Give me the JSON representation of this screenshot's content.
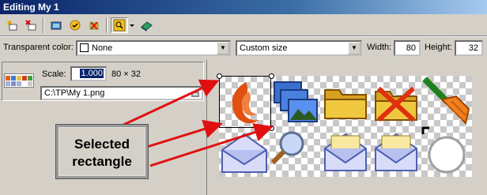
{
  "window": {
    "title": "Editing My 1"
  },
  "toolbar": {
    "buttons": [
      {
        "name": "new-layer-icon"
      },
      {
        "name": "delete-layer-icon"
      },
      {
        "name": "insert-image-icon"
      },
      {
        "name": "apply-icon"
      },
      {
        "name": "clear-icon"
      },
      {
        "name": "zoom-icon"
      },
      {
        "name": "dropdown-arrow-icon"
      },
      {
        "name": "book-icon"
      }
    ]
  },
  "options": {
    "transparent_color_label": "Transparent color:",
    "transparent_color_value": "None",
    "size_value": "Custom size",
    "width_label": "Width:",
    "width_value": "80",
    "height_label": "Height:",
    "height_value": "32"
  },
  "layer": {
    "scale_label": "Scale:",
    "scale_value": "1.000",
    "dimensions": "80 × 32",
    "path": "C:\\TP\\My 1.png"
  },
  "annotation": {
    "line1": "Selected",
    "line2": "rectangle"
  },
  "colors": {
    "title_start": "#0a246a",
    "arrow": "#e01010",
    "panel": "#d4d0c8"
  }
}
